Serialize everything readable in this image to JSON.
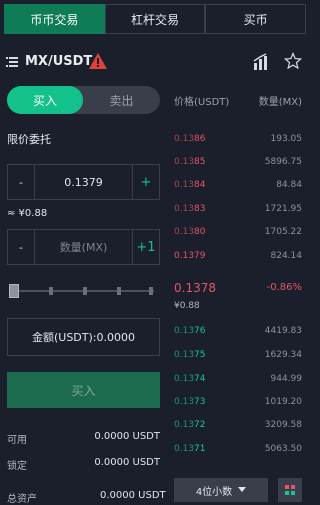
{
  "tabs": [
    {
      "label": "币币交易",
      "active": true
    },
    {
      "label": "杠杆交易",
      "active": false
    },
    {
      "label": "买币",
      "active": false
    }
  ],
  "header": {
    "pair": "MX/USDT",
    "icons": [
      "menu-icon",
      "warning-icon",
      "chart-icon",
      "star-icon"
    ]
  },
  "trade": {
    "buy_label": "买入",
    "sell_label": "卖出",
    "order_type": "限价委托",
    "price": {
      "minus": "-",
      "value": "0.1379",
      "plus": "+"
    },
    "approx": "≈ ¥0.88",
    "qty": {
      "minus": "-",
      "placeholder": "数量(MX)",
      "plus": "+1"
    },
    "slider_percent": 0,
    "amount_label": "金额(USDT):0.0000",
    "submit_label": "买入"
  },
  "balances": {
    "available_label": "可用",
    "available_value": "0.0000 USDT",
    "locked_label": "锁定",
    "locked_value": "0.0000 USDT",
    "total_label": "总资产",
    "total_value": "0.0000 USDT"
  },
  "orderbook": {
    "price_header": "价格(USDT)",
    "qty_header": "数量(MX)",
    "asks": [
      {
        "prefix": "0.13",
        "suffix": "86",
        "qty": "193.05"
      },
      {
        "prefix": "0.13",
        "suffix": "85",
        "qty": "5896.75"
      },
      {
        "prefix": "0.13",
        "suffix": "84",
        "qty": "84.84"
      },
      {
        "prefix": "0.13",
        "suffix": "83",
        "qty": "1721.95"
      },
      {
        "prefix": "0.13",
        "suffix": "80",
        "qty": "1705.22"
      },
      {
        "prefix": "",
        "suffix": "0.1379",
        "qty": "824.14"
      }
    ],
    "last_price": "0.1378",
    "last_cny": "¥0.88",
    "change": "-0.86%",
    "bids": [
      {
        "prefix": "0.13",
        "suffix": "76",
        "qty": "4419.83"
      },
      {
        "prefix": "0.13",
        "suffix": "75",
        "qty": "1629.34"
      },
      {
        "prefix": "0.13",
        "suffix": "74",
        "qty": "944.99"
      },
      {
        "prefix": "0.13",
        "suffix": "73",
        "qty": "1019.20"
      },
      {
        "prefix": "0.13",
        "suffix": "72",
        "qty": "3209.58"
      },
      {
        "prefix": "0.13",
        "suffix": "71",
        "qty": "5063.50"
      }
    ],
    "decimals_label": "4位小数"
  },
  "colors": {
    "green": "#12c28a",
    "red": "#e05666",
    "bg": "#1b1f2b"
  }
}
